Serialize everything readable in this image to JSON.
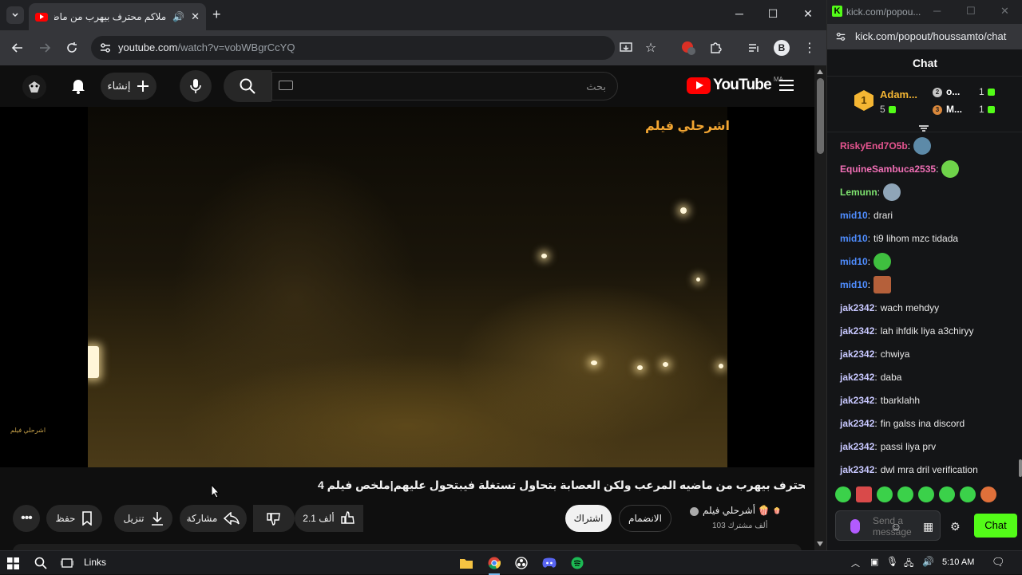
{
  "browser": {
    "tab_title": "ملاكم محترف بيهرب من ماض",
    "url_host": "youtube.com",
    "url_path": "/watch?v=vobWBgrCcYQ",
    "extension_badge": "1"
  },
  "youtube": {
    "create_label": "إنشاء",
    "search_placeholder": "بحث",
    "logo_word": "YouTube",
    "logo_country": "MA",
    "video_watermark": "اشرحلي فيلم",
    "video_small_watermark": "اشرحلي فيلم",
    "video_title": "ملاكم محترف بيهرب من ماضيه المرعب ولكن العصابة بتحاول تستغلة فيبتحول عليهم|ملخص فيلم 4K",
    "channel_name": "أشرحلي فيلم",
    "channel_subs": "103 ألف مشترك",
    "join_label": "الانضمام",
    "subscribe_label": "اشتراك",
    "like_count": "2.1 ألف",
    "share_label": "مشاركة",
    "download_label": "تنزيل",
    "save_label": "حفظ"
  },
  "kick": {
    "window_title": "kick.com/popou...",
    "url": "kick.com/popout/houssamto/chat",
    "chat_header": "Chat",
    "leaderboard": {
      "first": {
        "rank": "1",
        "name": "Adam...",
        "count": "5"
      },
      "second": {
        "name": "o...",
        "count": "1"
      },
      "third": {
        "name": "M...",
        "count": "1"
      }
    },
    "messages": [
      {
        "user": "RiskyEnd7O5b",
        "text": "",
        "color": "#e5548f",
        "emote": "#5d8aa8"
      },
      {
        "user": "EquineSambuca2535",
        "text": "",
        "color": "#f06fb5",
        "emote": "#6fd34a"
      },
      {
        "user": "Lemunn",
        "text": "",
        "color": "#7ee36f",
        "emote": "#8fa5b8"
      },
      {
        "user": "mid10",
        "text": "drari",
        "color": "#4f8dff",
        "emote": ""
      },
      {
        "user": "mid10",
        "text": "ti9 lihom mzc tidada",
        "color": "#4f8dff",
        "emote": ""
      },
      {
        "user": "mid10",
        "text": "",
        "color": "#4f8dff",
        "emote": "#3fbf3f"
      },
      {
        "user": "mid10",
        "text": "",
        "color": "#4f8dff",
        "emote": "#b5603a"
      },
      {
        "user": "jak2342",
        "text": "wach mehdyy",
        "color": "#c8c8ff",
        "emote": ""
      },
      {
        "user": "jak2342",
        "text": "lah ihfdik liya a3chiryy",
        "color": "#c8c8ff",
        "emote": ""
      },
      {
        "user": "jak2342",
        "text": "chwiya",
        "color": "#c8c8ff",
        "emote": ""
      },
      {
        "user": "jak2342",
        "text": "daba",
        "color": "#c8c8ff",
        "emote": ""
      },
      {
        "user": "jak2342",
        "text": "tbarklahh",
        "color": "#c8c8ff",
        "emote": ""
      },
      {
        "user": "jak2342",
        "text": "fin galss ina discord",
        "color": "#c8c8ff",
        "emote": ""
      },
      {
        "user": "jak2342",
        "text": "passi liya prv",
        "color": "#c8c8ff",
        "emote": ""
      },
      {
        "user": "jak2342",
        "text": "dwl mra dril verification",
        "color": "#c8c8ff",
        "emote": ""
      }
    ],
    "input_placeholder": "Send a message",
    "send_label": "Chat"
  },
  "taskbar": {
    "links_label": "Links",
    "time": "5:10 AM"
  },
  "colors": {
    "kick_green": "#53fc18",
    "yt_red": "#ff0000",
    "yt_bg": "#0f0f0f"
  }
}
